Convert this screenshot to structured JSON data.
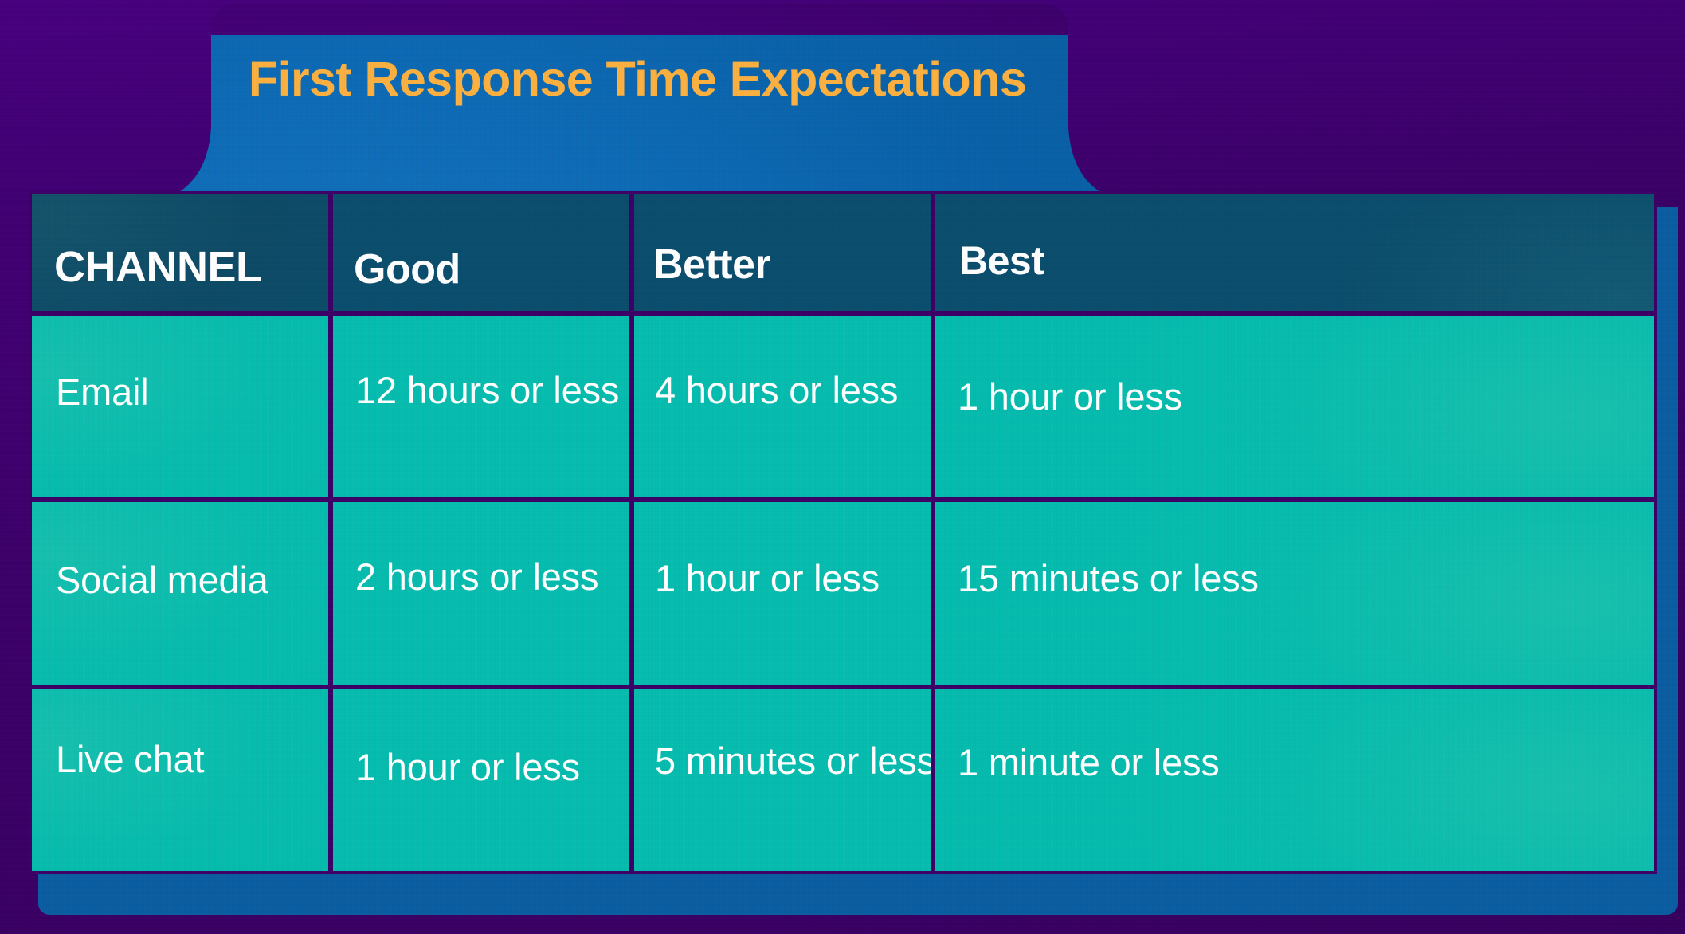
{
  "title": "First Response Time Expectations",
  "colors": {
    "background_purple": "#3c0069",
    "card_blue": "#0d6ab5",
    "title_orange": "#fbb040",
    "table_border_purple": "#3d0066",
    "header_cell_teal_blue": "#0a4d6c",
    "body_cell_teal": "#06bcae",
    "text_white": "#ffffff"
  },
  "table": {
    "headers": [
      "CHANNEL",
      "Good",
      "Better",
      "Best"
    ],
    "rows": [
      {
        "channel": "Email",
        "good": "12 hours or less",
        "better": "4 hours or less",
        "best": "1 hour or less"
      },
      {
        "channel": "Social media",
        "good": "2 hours or less",
        "better": "1 hour or less",
        "best": "15 minutes or less"
      },
      {
        "channel": "Live chat",
        "good": "1 hour or less",
        "better": "5 minutes or less",
        "best": "1 minute or less"
      }
    ]
  }
}
